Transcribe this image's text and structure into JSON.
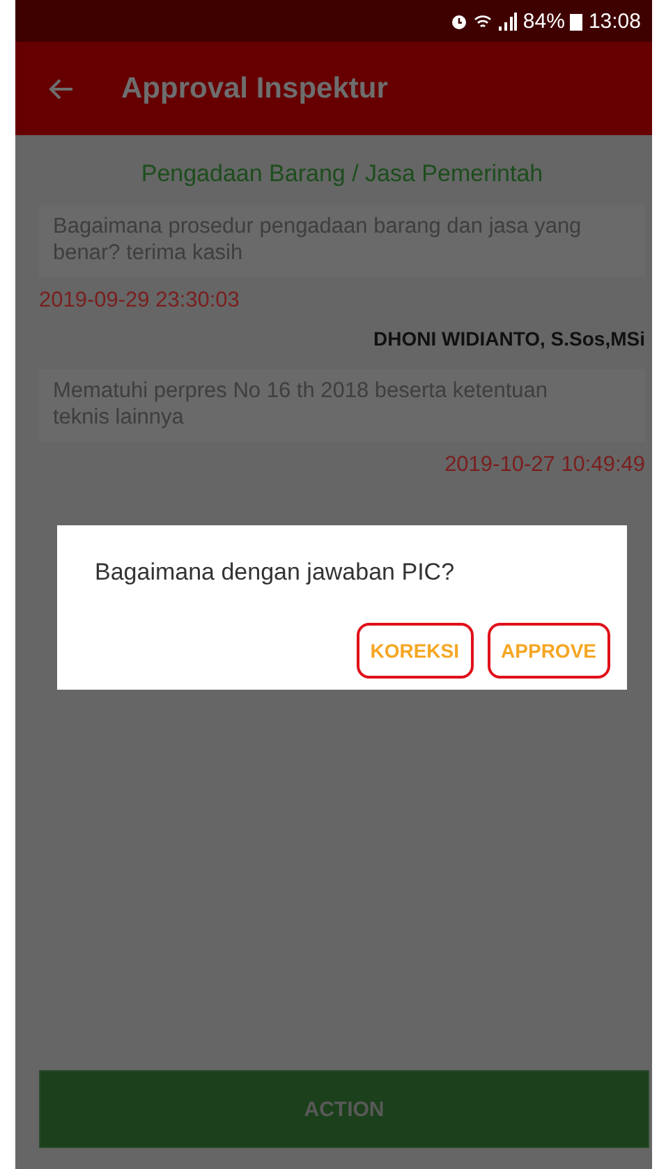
{
  "status_bar": {
    "battery": "84%",
    "time": "13:08"
  },
  "app_bar": {
    "title": "Approval Inspektur"
  },
  "topic": "Pengadaan Barang / Jasa Pemerintah",
  "question": {
    "text": "Bagaimana prosedur pengadaan barang dan jasa yang benar? terima kasih",
    "time": "2019-09-29 23:30:03"
  },
  "answerer": "DHONI WIDIANTO, S.Sos,MSi",
  "answer": {
    "text": "Mematuhi perpres No 16 th 2018 beserta ketentuan teknis lainnya",
    "time": "2019-10-27 10:49:49"
  },
  "dialog": {
    "message": "Bagaimana dengan jawaban PIC?",
    "buttons": [
      {
        "label": "KOREKSI",
        "circled": true
      },
      {
        "label": "APPROVE",
        "circled": true
      }
    ]
  },
  "action_button": "ACTION"
}
